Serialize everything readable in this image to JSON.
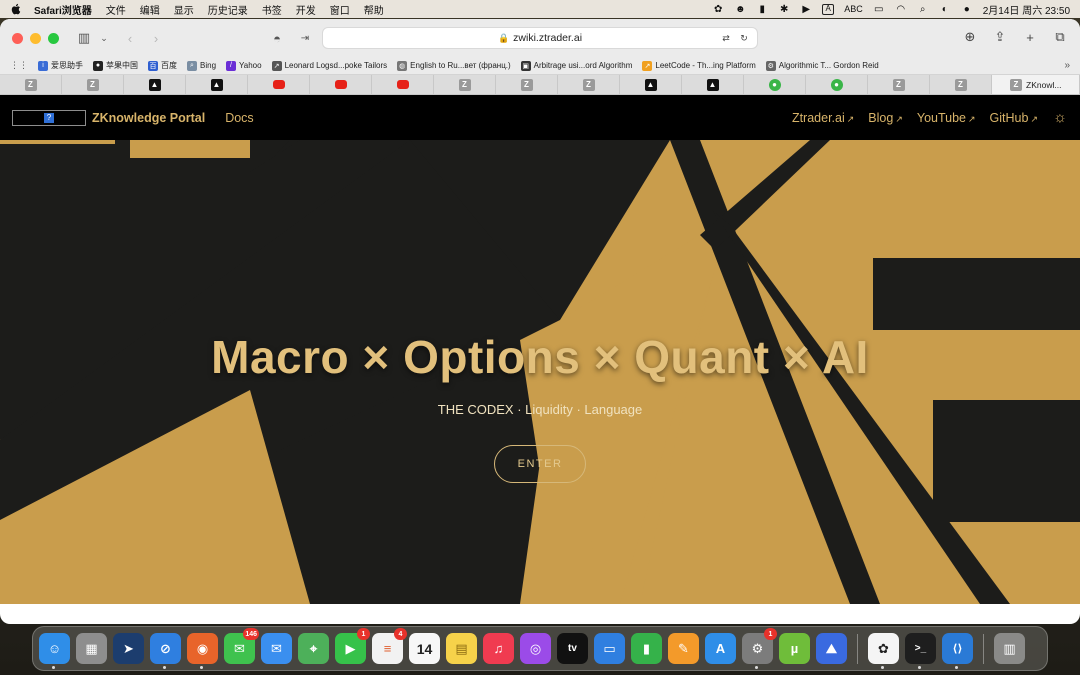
{
  "menubar": {
    "app_name": "Safari浏览器",
    "items": [
      "文件",
      "编辑",
      "显示",
      "历史记录",
      "书签",
      "开发",
      "窗口",
      "帮助"
    ],
    "input_method": "ABC",
    "datetime": "2月14日 周六  23:50"
  },
  "browser": {
    "url": "zwiki.ztrader.ai",
    "bookmarks": [
      {
        "label": "爱思助手",
        "icon": "i4-icon",
        "color": "#3a6cd6"
      },
      {
        "label": "苹果中国",
        "icon": "apple-icon",
        "color": "#222222"
      },
      {
        "label": "百度",
        "icon": "baidu-icon",
        "color": "#2f5fd0"
      },
      {
        "label": "Bing",
        "icon": "search-icon",
        "color": "#7a8ea3"
      },
      {
        "label": "Yahoo",
        "icon": "yahoo-icon",
        "color": "#6b2fd6"
      },
      {
        "label": "Leonard Logsd...poke Tailors",
        "icon": "tailor-icon",
        "color": "#555555"
      },
      {
        "label": "English to Ru...вет (франц.)",
        "icon": "globe-icon",
        "color": "#777777"
      },
      {
        "label": "Arbitrage usi...ord Algorithm",
        "icon": "doc-icon",
        "color": "#333333"
      },
      {
        "label": "LeetCode - Th...ing Platform",
        "icon": "leetcode-icon",
        "color": "#f0a020"
      },
      {
        "label": "Algorithmic T... Gordon Reid",
        "icon": "gear-icon",
        "color": "#666666"
      }
    ],
    "tabs": [
      {
        "type": "z"
      },
      {
        "type": "z"
      },
      {
        "type": "tri"
      },
      {
        "type": "tri"
      },
      {
        "type": "yt"
      },
      {
        "type": "yt"
      },
      {
        "type": "yt"
      },
      {
        "type": "z"
      },
      {
        "type": "z"
      },
      {
        "type": "z"
      },
      {
        "type": "tri"
      },
      {
        "type": "tri"
      },
      {
        "type": "wx"
      },
      {
        "type": "wx"
      },
      {
        "type": "z"
      },
      {
        "type": "z"
      }
    ],
    "active_tab": {
      "label": "ZKnowl..."
    }
  },
  "site": {
    "logo_icon": "broken-image-icon",
    "brand": "ZKnowledge Portal",
    "docs": "Docs",
    "nav_links": [
      {
        "label": "Ztrader.ai"
      },
      {
        "label": "Blog"
      },
      {
        "label": "YouTube"
      },
      {
        "label": "GitHub"
      }
    ],
    "theme_toggle_icon": "sun-icon"
  },
  "hero": {
    "title": "Macro × Options × Quant × AI",
    "subtitle": "THE CODEX · Liquidity · Language",
    "cta": "ENTER",
    "colors": {
      "gold": "#c99d4c",
      "dark": "#1c1c1a",
      "title": "#e2c07c"
    }
  },
  "dock": {
    "apps": [
      {
        "name": "finder",
        "color": "#2f8ee8",
        "glyph": "☺"
      },
      {
        "name": "launchpad",
        "color": "#8e8e8e",
        "glyph": "▦"
      },
      {
        "name": "copilot-nav",
        "color": "#1c3d6e",
        "glyph": "➤"
      },
      {
        "name": "safari",
        "color": "#2f7fe0",
        "glyph": "⊘"
      },
      {
        "name": "firefox",
        "color": "#e8642a",
        "glyph": "◉"
      },
      {
        "name": "messages",
        "color": "#3fc24e",
        "glyph": "✉",
        "badge": "146"
      },
      {
        "name": "mail",
        "color": "#3a8fef",
        "glyph": "✉"
      },
      {
        "name": "maps",
        "color": "#4db05a",
        "glyph": "⌖"
      },
      {
        "name": "facetime",
        "color": "#36c24a",
        "glyph": "▶",
        "badge": "1"
      },
      {
        "name": "reminders",
        "color": "#f2f2f2",
        "glyph": "≡",
        "badge": "4"
      },
      {
        "name": "calendar",
        "color": "#f7f7f7",
        "glyph": "14"
      },
      {
        "name": "notes",
        "color": "#f6d24a",
        "glyph": "▤"
      },
      {
        "name": "music",
        "color": "#f03b50",
        "glyph": "♫"
      },
      {
        "name": "podcasts",
        "color": "#9b4be8",
        "glyph": "◎"
      },
      {
        "name": "apple-tv",
        "color": "#111111",
        "glyph": "tv"
      },
      {
        "name": "keynote",
        "color": "#2f7fe0",
        "glyph": "▭"
      },
      {
        "name": "numbers",
        "color": "#35b24a",
        "glyph": "▮"
      },
      {
        "name": "pages",
        "color": "#f39a2a",
        "glyph": "✎"
      },
      {
        "name": "app-store",
        "color": "#2f8ee8",
        "glyph": "A"
      },
      {
        "name": "system-settings",
        "color": "#7c7c7c",
        "glyph": "⚙",
        "badge": "1"
      },
      {
        "name": "utorrent",
        "color": "#6fbd3a",
        "glyph": "µ"
      },
      {
        "name": "nordvpn",
        "color": "#3a6ae0",
        "glyph": "⛰"
      },
      {
        "name": "chatgpt",
        "color": "#f5f5f5",
        "glyph": "✿"
      },
      {
        "name": "terminal",
        "color": "#1e1e1e",
        "glyph": ">_"
      },
      {
        "name": "vscode",
        "color": "#2a7ad6",
        "glyph": "⟨⟩"
      },
      {
        "name": "trash",
        "color": "#8a8a88",
        "glyph": "🗑"
      }
    ]
  }
}
